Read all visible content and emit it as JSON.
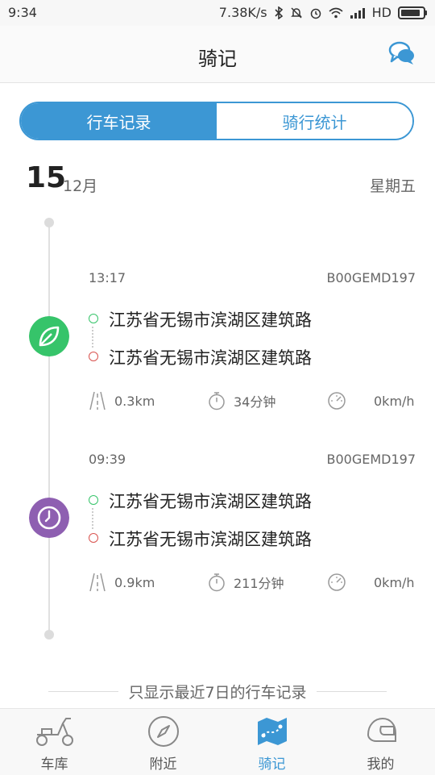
{
  "status_bar": {
    "time": "9:34",
    "net_speed": "7.38K/s",
    "network": "HD",
    "icons": [
      "bluetooth-icon",
      "notifications-off-icon",
      "alarm-icon",
      "wifi-icon",
      "signal-icon",
      "battery-icon"
    ]
  },
  "header": {
    "title": "骑记",
    "chat_icon": "chat-bubbles-icon",
    "accent_color": "#3c97d4"
  },
  "segment": {
    "tabs": [
      {
        "label": "行车记录",
        "active": true
      },
      {
        "label": "骑行统计",
        "active": false
      }
    ]
  },
  "date": {
    "day": "15",
    "month": "12月",
    "weekday": "星期五"
  },
  "trips": [
    {
      "time": "13:17",
      "plate": "B00GEMD197",
      "badge_icon": "leaf-icon",
      "badge_color": "#36c46a",
      "start": "江苏省无锡市滨湖区建筑路",
      "end": "江苏省无锡市滨湖区建筑路",
      "distance": "0.3km",
      "duration": "34分钟",
      "speed": "0km/h"
    },
    {
      "time": "09:39",
      "plate": "B00GEMD197",
      "badge_icon": "clock-icon",
      "badge_color": "#8e5fb1",
      "start": "江苏省无锡市滨湖区建筑路",
      "end": "江苏省无锡市滨湖区建筑路",
      "distance": "0.9km",
      "duration": "211分钟",
      "speed": "0km/h"
    }
  ],
  "notice": "只显示最近7日的行车记录",
  "bottom_nav": [
    {
      "label": "车库",
      "icon": "scooter-icon",
      "active": false
    },
    {
      "label": "附近",
      "icon": "compass-icon",
      "active": false
    },
    {
      "label": "骑记",
      "icon": "map-route-icon",
      "active": true
    },
    {
      "label": "我的",
      "icon": "helmet-icon",
      "active": false
    }
  ]
}
